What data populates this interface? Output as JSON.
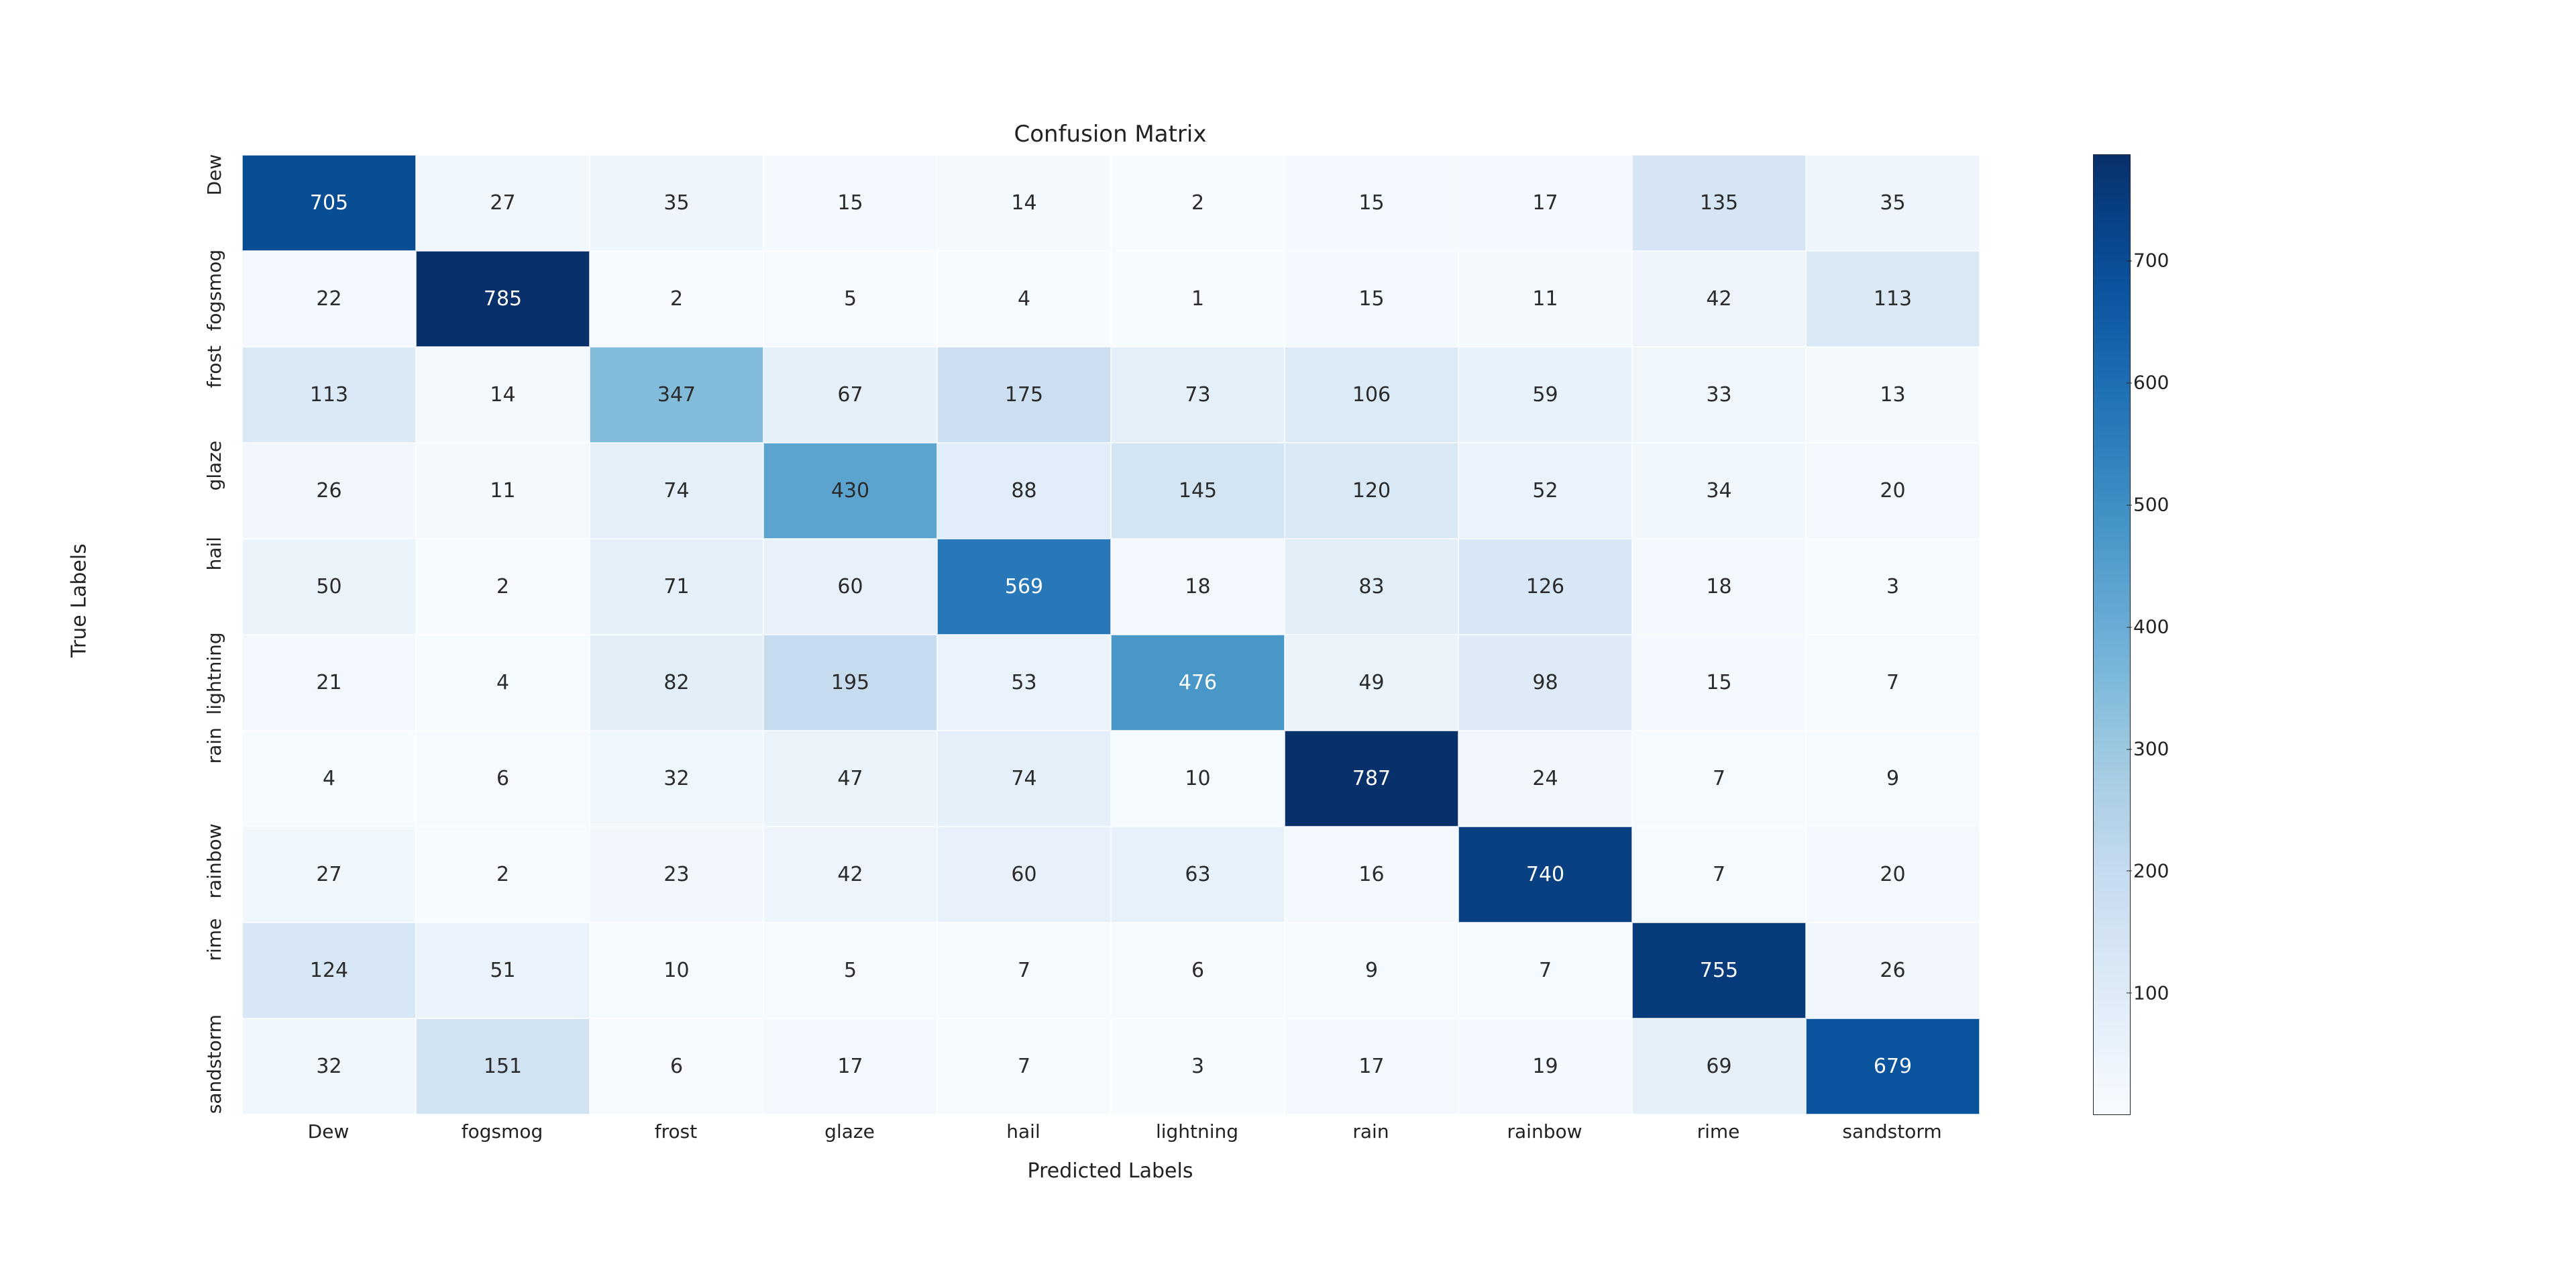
{
  "chart_data": {
    "type": "heatmap",
    "title": "Confusion Matrix",
    "xlabel": "Predicted Labels",
    "ylabel": "True Labels",
    "row_labels": [
      "Dew",
      "fogsmog",
      "frost",
      "glaze",
      "hail",
      "lightning",
      "rain",
      "rainbow",
      "rime",
      "sandstorm"
    ],
    "col_labels": [
      "Dew",
      "fogsmog",
      "frost",
      "glaze",
      "hail",
      "lightning",
      "rain",
      "rainbow",
      "rime",
      "sandstorm"
    ],
    "matrix": [
      [
        705,
        27,
        35,
        15,
        14,
        2,
        15,
        17,
        135,
        35
      ],
      [
        22,
        785,
        2,
        5,
        4,
        1,
        15,
        11,
        42,
        113
      ],
      [
        113,
        14,
        347,
        67,
        175,
        73,
        106,
        59,
        33,
        13
      ],
      [
        26,
        11,
        74,
        430,
        88,
        145,
        120,
        52,
        34,
        20
      ],
      [
        50,
        2,
        71,
        60,
        569,
        18,
        83,
        126,
        18,
        3
      ],
      [
        21,
        4,
        82,
        195,
        53,
        476,
        49,
        98,
        15,
        7
      ],
      [
        4,
        6,
        32,
        47,
        74,
        10,
        787,
        24,
        7,
        9
      ],
      [
        27,
        2,
        23,
        42,
        60,
        63,
        16,
        740,
        7,
        20
      ],
      [
        124,
        51,
        10,
        5,
        7,
        6,
        9,
        7,
        755,
        26
      ],
      [
        32,
        151,
        6,
        17,
        7,
        3,
        17,
        19,
        69,
        679
      ]
    ],
    "colorbar_ticks": [
      100,
      200,
      300,
      400,
      500,
      600,
      700
    ],
    "vmin": 1,
    "vmax": 787
  }
}
